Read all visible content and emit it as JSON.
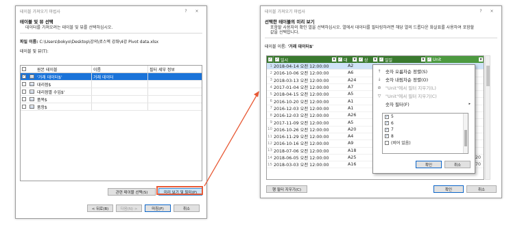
{
  "left": {
    "title": "테이블 가져오기 마법사",
    "help": "?",
    "close": "×",
    "heading": "테이블 및 뷰 선택",
    "description": "데이터를 가져오려는 테이블 및 뷰를 선택하십시오.",
    "file_label": "파일 이름:",
    "file_path": "C:\\Users\\bokyo\\Desktop\\강의\\로스엑 강좌\\4강 Pivot data.xlsx",
    "tables_label": "테이블 및 뷰(T):",
    "columns": [
      "원본 테이블",
      "이름",
      "필터 세부 정보"
    ],
    "rows": [
      {
        "source": "'거래 데이터$'",
        "name": "거래 데이터",
        "filter": "",
        "checked": true,
        "selected": true
      },
      {
        "source": "대리점$",
        "name": "",
        "filter": "",
        "checked": false,
        "selected": false
      },
      {
        "source": "대리점별 수입$'",
        "name": "",
        "filter": "",
        "checked": false,
        "selected": false
      },
      {
        "source": "품목$",
        "name": "",
        "filter": "",
        "checked": false,
        "selected": false
      },
      {
        "source": "품항$",
        "name": "",
        "filter": "",
        "checked": false,
        "selected": false
      }
    ],
    "btn_related": "관련 테이블 선택(S)",
    "btn_preview": "미리 보기 및 필터(P)",
    "btn_back": "< 뒤로(B)",
    "btn_next": "다음(N) >",
    "btn_finish": "마침(F)",
    "btn_cancel": "취소"
  },
  "right": {
    "title": "테이블 가져오기 마법사",
    "help": "?",
    "close": "×",
    "heading": "선택한 테이블의 미리 보기",
    "description": "포함할 사용자의 확인 열을 선택하십시오. 열에서 데이터를 필터링하려면 해당 열의 드롭다운 화살표를 사용하여 포함할 값을 선택합니다.",
    "table_label": "테이블 이름:",
    "table_name": "'거래 데이터$'",
    "headers": [
      "일시",
      "대",
      "상",
      "일일",
      "Unit"
    ],
    "rows": [
      {
        "n": "1",
        "dt": "2018-04-14 오전 12:00:00",
        "code": "A2",
        "q": "",
        "u": ""
      },
      {
        "n": "2",
        "dt": "2016-10-06 오전 12:00:00",
        "code": "A6",
        "q": "",
        "u": ""
      },
      {
        "n": "3",
        "dt": "2018-03-13 오전 12:00:00",
        "code": "A24",
        "q": "",
        "u": ""
      },
      {
        "n": "4",
        "dt": "2017-01-04 오전 12:00:00",
        "code": "A7",
        "q": "",
        "u": ""
      },
      {
        "n": "5",
        "dt": "2018-04-15 오전 12:00:00",
        "code": "A5",
        "q": "",
        "u": ""
      },
      {
        "n": "6",
        "dt": "2016-10-20 오전 12:00:00",
        "code": "A1",
        "q": "",
        "u": ""
      },
      {
        "n": "7",
        "dt": "2016-12-03 오전 12:00:00",
        "code": "A1",
        "q": "",
        "u": ""
      },
      {
        "n": "8",
        "dt": "2016-12-03 오전 12:00:00",
        "code": "A26",
        "q": "",
        "u": ""
      },
      {
        "n": "9",
        "dt": "2017-11-09 오전 12:00:00",
        "code": "A5",
        "q": "",
        "u": ""
      },
      {
        "n": "10",
        "dt": "2016-10-26 오전 12:00:00",
        "code": "A20",
        "q": "",
        "u": ""
      },
      {
        "n": "11",
        "dt": "2016-11-29 오전 12:00:00",
        "code": "A4",
        "q": "",
        "u": ""
      },
      {
        "n": "12",
        "dt": "2016-10-16 오전 12:00:00",
        "code": "A9",
        "q": "",
        "u": ""
      },
      {
        "n": "13",
        "dt": "2018-07-06 오전 12:00:00",
        "code": "A18",
        "q": "",
        "u": ""
      },
      {
        "n": "14",
        "dt": "2018-06-05 오전 12:00:00",
        "code": "A25",
        "q": "2",
        "u": "620"
      },
      {
        "n": "15",
        "dt": "2018-03-03 오전 12:00:00",
        "code": "A16",
        "q": "2",
        "u": "670"
      }
    ],
    "filter_menu": {
      "sort_asc": "숫자 오름차순 정렬(S)",
      "sort_desc": "숫자 내림차순 정렬(O)",
      "clear_filter": "\"Unit\"에서 필터 지우기(L)",
      "clear_filter2": "\"Unit\"에서 필터 지우기(C)",
      "number_filter": "숫자 필터(F)",
      "values": [
        {
          "label": "5",
          "checked": true
        },
        {
          "label": "6",
          "checked": true
        },
        {
          "label": "7",
          "checked": true
        },
        {
          "label": "8",
          "checked": true
        },
        {
          "label": "(비어 있음)",
          "checked": false
        }
      ],
      "ok": "확인",
      "cancel": "취소"
    },
    "btn_clear": "행 필터 지우기(C)",
    "btn_ok": "확인",
    "btn_cancel": "취소"
  },
  "colors": {
    "header_green": "#3a7a2f",
    "selection_blue": "#1a73d9",
    "highlight_red": "#e85a36"
  }
}
